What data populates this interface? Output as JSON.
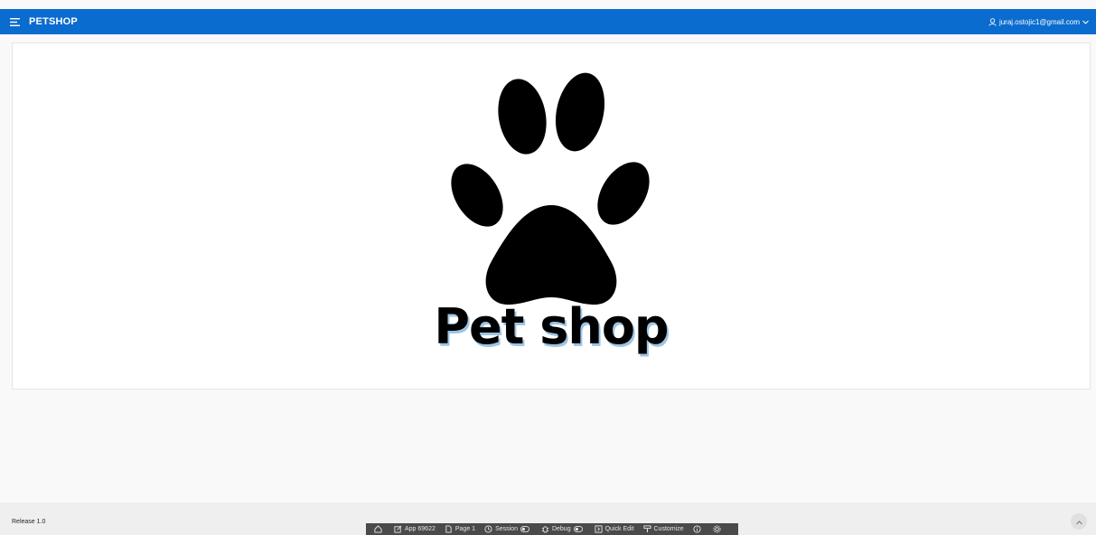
{
  "header": {
    "app_title": "PETSHOP",
    "menu_icon": "hamburger-icon",
    "user_icon": "user-icon",
    "user_email": "juraj.ostojic1@gmail.com",
    "dropdown_icon": "chevron-down-icon",
    "background": "#0a6ccf"
  },
  "main": {
    "logo_icon": "paw-icon",
    "hero_text": "Pet shop"
  },
  "footer": {
    "release": "Release 1.0",
    "scroll_top_icon": "chevron-up-icon"
  },
  "dev_toolbar": {
    "home_icon": "home-icon",
    "app_label": "App 69622",
    "page_label": "Page 1",
    "session_label": "Session",
    "debug_label": "Debug",
    "quick_edit_label": "Quick Edit",
    "customize_label": "Customize",
    "info_icon": "info-icon",
    "settings_icon": "gear-icon"
  }
}
